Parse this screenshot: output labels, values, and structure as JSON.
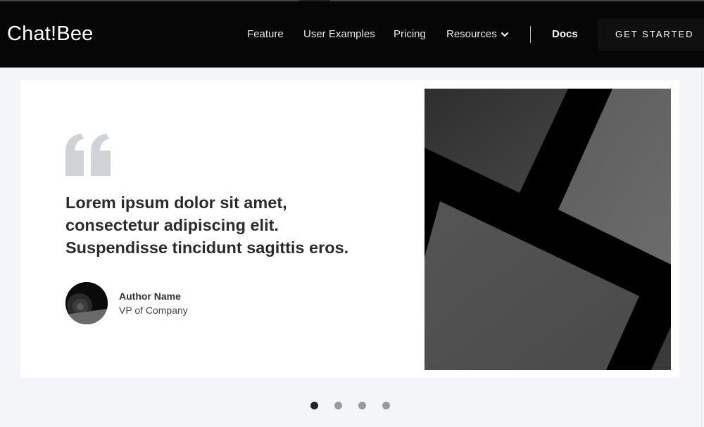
{
  "header": {
    "logo": "Chat!Bee",
    "nav": {
      "feature": "Feature",
      "examples": "User Examples",
      "pricing": "Pricing",
      "resources": "Resources",
      "docs": "Docs"
    },
    "cta": "GET STARTED"
  },
  "testimonial": {
    "quote": "Lorem ipsum dolor sit amet, consectetur adipiscing elit. Suspendisse tincidunt sagittis eros.",
    "author_name": "Author Name",
    "author_role": "VP of Company"
  },
  "carousel": {
    "slide_count": 4,
    "active_index": 0
  },
  "colors": {
    "header_bg": "#060606",
    "page_bg": "#f4f5f9",
    "quote_mark": "#cfd3d8",
    "text_dark": "#2b2b2b",
    "dot_active": "#222222",
    "dot_inactive": "#9a9a9a"
  },
  "icons": {
    "resources_dropdown": "chevron-down-icon",
    "quote": "quote-icon"
  }
}
